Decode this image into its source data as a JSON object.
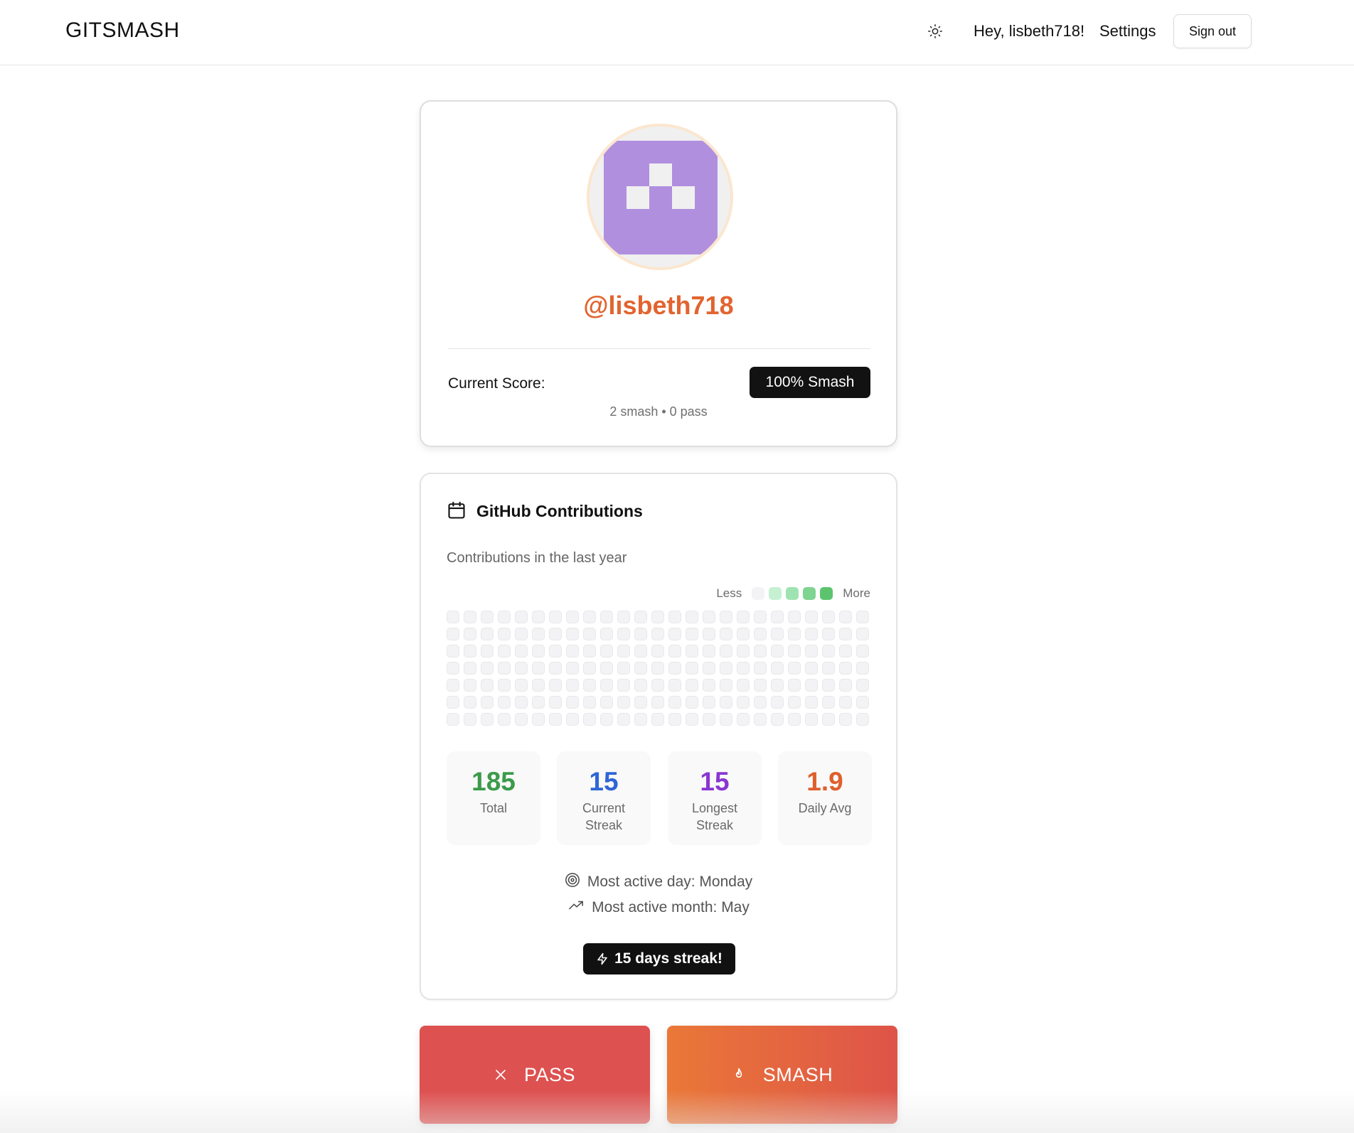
{
  "header": {
    "brand": "GITSMASH",
    "theme_icon": "sun-icon",
    "greeting": "Hey, lisbeth718!",
    "settings_label": "Settings",
    "signout_label": "Sign out"
  },
  "profile": {
    "avatar_icon": "identicon-avatar",
    "username": "@lisbeth718",
    "score_label": "Current Score:",
    "score_badge": "100% Smash",
    "score_breakdown": "2 smash • 0 pass"
  },
  "contributions": {
    "title_icon": "calendar-icon",
    "title": "GitHub Contributions",
    "subtitle": "Contributions in the last year",
    "legend": {
      "less": "Less",
      "more": "More",
      "colors": [
        "#f3f3f5",
        "#c6f0d2",
        "#a0e3b2",
        "#7ed491",
        "#5cc46f"
      ]
    },
    "heatmap": {
      "weeks": 25,
      "days": 7,
      "empty_color": "#f3f3f5"
    },
    "stats": [
      {
        "value": "185",
        "label": "Total",
        "color": "#3b9b4a"
      },
      {
        "value": "15",
        "label": "Current Streak",
        "color": "#2f66d6"
      },
      {
        "value": "15",
        "label": "Longest Streak",
        "color": "#8a36d2"
      },
      {
        "value": "1.9",
        "label": "Daily Avg",
        "color": "#df5f2c"
      }
    ],
    "most_active_day": "Most active day: Monday",
    "most_active_month": "Most active month: May",
    "streak_badge": "15 days streak!"
  },
  "actions": {
    "pass_label": "PASS",
    "smash_label": "SMASH"
  }
}
